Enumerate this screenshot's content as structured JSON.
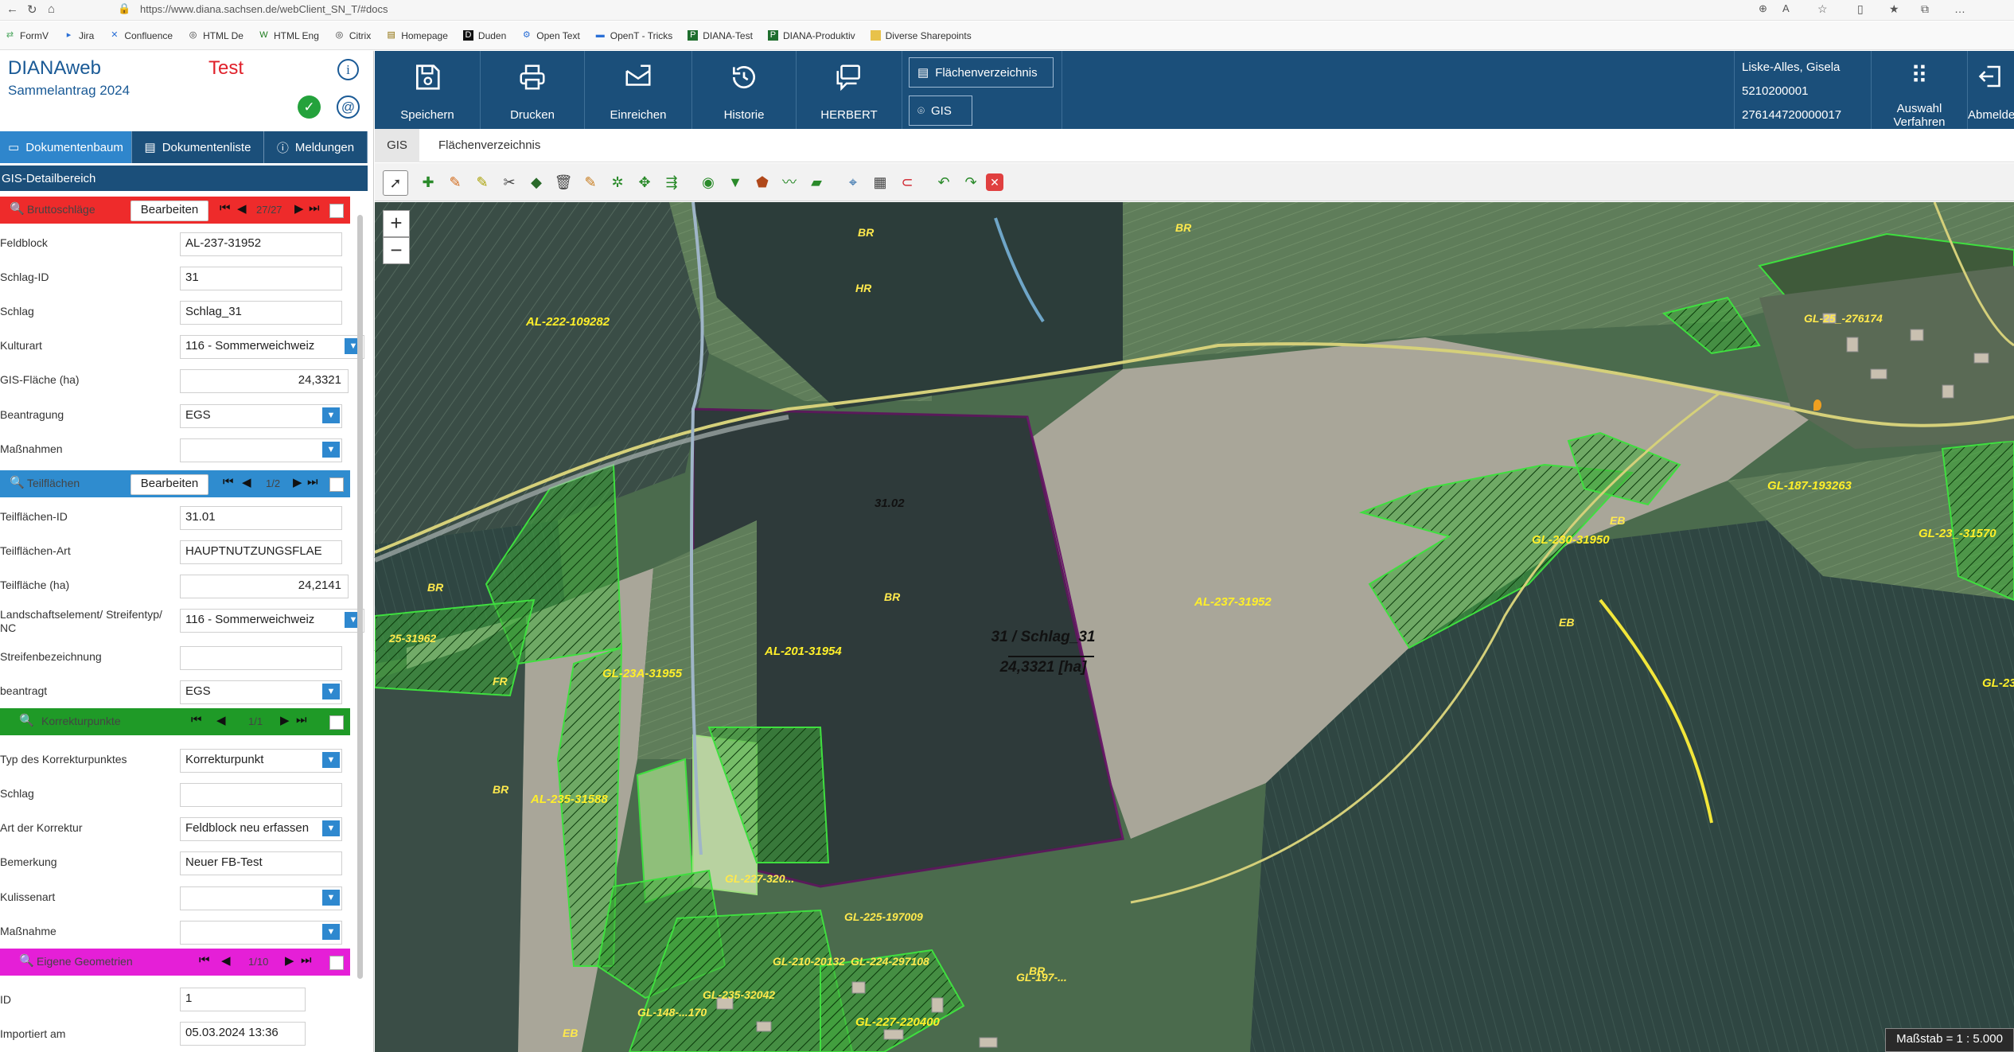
{
  "browser": {
    "url": "https://www.diana.sachsen.de/webClient_SN_T/#docs",
    "bookmarks": [
      "FormV",
      "Jira",
      "Confluence",
      "HTML De",
      "HTML Eng",
      "Citrix",
      "Homepage",
      "Duden",
      "Open Text",
      "OpenT - Tricks",
      "DIANA-Test",
      "DIANA-Produktiv",
      "Diverse Sharepoints"
    ]
  },
  "app": {
    "name": "DIANAweb",
    "subtitle": "Sammelantrag 2024",
    "environment": "Test"
  },
  "tabs": [
    "Dokumentenbaum",
    "Dokumentenliste",
    "Meldungen"
  ],
  "detail_header": "GIS-Detailbereich",
  "sections": {
    "brutto": {
      "label": "Bruttoschläge",
      "edit": "Bearbeiten",
      "count": "27/27",
      "color": "#ee2b2b"
    },
    "teil": {
      "label": "Teilflächen",
      "edit": "Bearbeiten",
      "count": "1/2",
      "color": "#2f8ccf"
    },
    "korrektur": {
      "label": "Korrekturpunkte",
      "count": "1/1",
      "color": "#1f9a27"
    },
    "geom": {
      "label": "Eigene Geometrien",
      "count": "1/10",
      "color": "#e51fd7"
    }
  },
  "fields": {
    "feldblock": {
      "label": "Feldblock",
      "value": "AL-237-31952"
    },
    "schlag_id": {
      "label": "Schlag-ID",
      "value": "31"
    },
    "schlag": {
      "label": "Schlag",
      "value": "Schlag_31"
    },
    "kulturart": {
      "label": "Kulturart",
      "value": "116 - Sommerweichweiz"
    },
    "gis_flaeche": {
      "label": "GIS-Fläche (ha)",
      "value": "24,3321"
    },
    "beantragung": {
      "label": "Beantragung",
      "value": "EGS"
    },
    "massnahmen": {
      "label": "Maßnahmen",
      "value": ""
    },
    "tf_id": {
      "label": "Teilflächen-ID",
      "value": "31.01"
    },
    "tf_art": {
      "label": "Teilflächen-Art",
      "value": "HAUPTNUTZUNGSFLAE"
    },
    "tf_flaeche": {
      "label": "Teilfläche (ha)",
      "value": "24,2141"
    },
    "landschaft": {
      "label": "Landschaftselement/ Streifentyp/ NC",
      "value": "116 - Sommerweichweiz"
    },
    "streifen": {
      "label": "Streifenbezeichnung",
      "value": ""
    },
    "beantragt": {
      "label": "beantragt",
      "value": "EGS"
    },
    "typ_korr": {
      "label": "Typ des Korrekturpunktes",
      "value": "Korrekturpunkt"
    },
    "k_schlag": {
      "label": "Schlag",
      "value": ""
    },
    "art_korr": {
      "label": "Art der Korrektur",
      "value": "Feldblock neu erfassen"
    },
    "bemerkung": {
      "label": "Bemerkung",
      "value": "Neuer FB-Test"
    },
    "kulissenart": {
      "label": "Kulissenart",
      "value": ""
    },
    "massnahme": {
      "label": "Maßnahme",
      "value": ""
    },
    "id": {
      "label": "ID",
      "value": "1"
    },
    "importiert": {
      "label": "Importiert am",
      "value": "05.03.2024 13:36"
    }
  },
  "header_buttons": [
    "Speichern",
    "Drucken",
    "Einreichen",
    "Historie",
    "HERBERT"
  ],
  "header_pills": [
    "Flächenverzeichnis",
    "GIS"
  ],
  "user": {
    "name": "Liske-Alles, Gisela",
    "number": "5210200001",
    "id": "276144720000017"
  },
  "auswahl_label": "Auswahl Verfahren",
  "abmelden_label": "Abmelden",
  "breadcrumb": [
    "GIS",
    "Flächenverzeichnis"
  ],
  "map": {
    "zoom_in": "+",
    "zoom_out": "−",
    "selected_parcel": "31 / Schlag_31",
    "selected_area": "24,3321 [ha]",
    "scale": "Maßstab = 1 : 5.000",
    "labels": {
      "l1": "AL-222-109282",
      "l2": "AL-237-31952",
      "l3": "AL-201-31954",
      "l4": "GL-23A-31955",
      "l5": "AL-235-31588",
      "l6": "GL-230-31950",
      "l7": "GL-187-193263",
      "l8": "GL-23_-31570",
      "l9": "GL-25_-276174",
      "l10": "GL-227-220400",
      "l11": "GL-225-197009",
      "l12": "GL-227-320...",
      "l13": "GL-210-20132",
      "l14": "GL-224-297108",
      "l15": "GL-197-...",
      "l16": "GL-235-32042",
      "l17": "GL-148-...170",
      "l18": "GL-23",
      "l19": "31.02",
      "l20": "25-31962",
      "br1": "BR",
      "br2": "BR",
      "br3": "BR",
      "br4": "BR",
      "br5": "BR",
      "br6": "BR",
      "hr": "HR",
      "eb1": "EB",
      "eb2": "EB",
      "eb3": "EB",
      "fr": "FR"
    }
  }
}
